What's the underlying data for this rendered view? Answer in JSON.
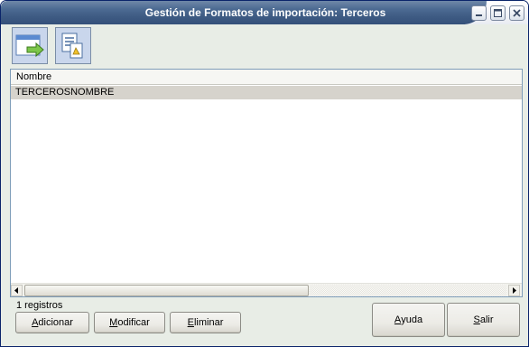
{
  "window": {
    "title": "Gestión de Formatos de importación: Terceros",
    "controls": [
      "minimize-icon",
      "maximize-icon",
      "close-icon"
    ]
  },
  "toolbar": {
    "buttons": [
      {
        "name": "import-format-button",
        "icon": "window-arrow-icon"
      },
      {
        "name": "format-details-button",
        "icon": "document-edit-icon"
      }
    ]
  },
  "grid": {
    "columns": [
      "Nombre"
    ],
    "rows": [
      [
        "TERCEROSNOMBRE"
      ]
    ],
    "selected_row": 0
  },
  "status": {
    "count_label": "1 registros"
  },
  "actions": {
    "add": {
      "first": "A",
      "rest": "dicionar"
    },
    "modify": {
      "first": "M",
      "rest": "odificar"
    },
    "delete": {
      "first": "E",
      "rest": "liminar"
    },
    "help": {
      "first": "A",
      "rest": "yuda"
    },
    "exit": {
      "first": "S",
      "rest": "alir"
    }
  },
  "colors": {
    "title_bar": "#3d5a82",
    "window_bg": "#e8ede6",
    "toolbar_button_bg": "#c9d6ec",
    "selected_row_bg": "#d6d3cc"
  }
}
